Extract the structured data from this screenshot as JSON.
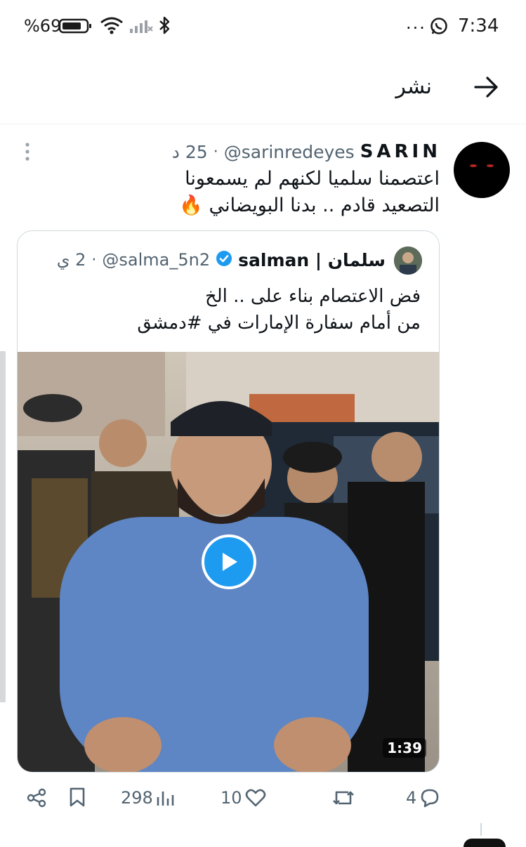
{
  "status_bar": {
    "time": "7:34",
    "battery": "%69",
    "more": "..."
  },
  "header": {
    "title": "نشر"
  },
  "tweet": {
    "display_name": "SARIN",
    "handle": "@sarinredeyes",
    "separator": "·",
    "time": "25 د",
    "line1": "اعتصمنا سلميا لكنهم لم يسمعونا",
    "line2": "التصعيد قادم .. بدنا البويضاني 🔥",
    "quote": {
      "display_name": "salman | سلمان",
      "handle": "@salma_5n2",
      "separator": "·",
      "time": "2 ي",
      "line1": "فض الاعتصام بناء على .. الخ",
      "line2": "من أمام سفارة الإمارات في #دمشق",
      "video_duration": "1:39"
    },
    "actions": {
      "replies": "4",
      "retweets": "",
      "likes": "10",
      "views": "298"
    }
  },
  "colors": {
    "accent": "#1d9bf0",
    "text": "#0f1419",
    "muted": "#536471",
    "border": "#cfd9de"
  },
  "icons": [
    "bluetooth-icon",
    "signal-icon",
    "wifi-icon",
    "battery-icon",
    "whatsapp-icon",
    "back-arrow-icon",
    "more-vertical-icon",
    "verified-badge-icon",
    "play-icon",
    "share-icon",
    "bookmark-icon",
    "views-icon",
    "like-icon",
    "retweet-icon",
    "reply-icon"
  ]
}
